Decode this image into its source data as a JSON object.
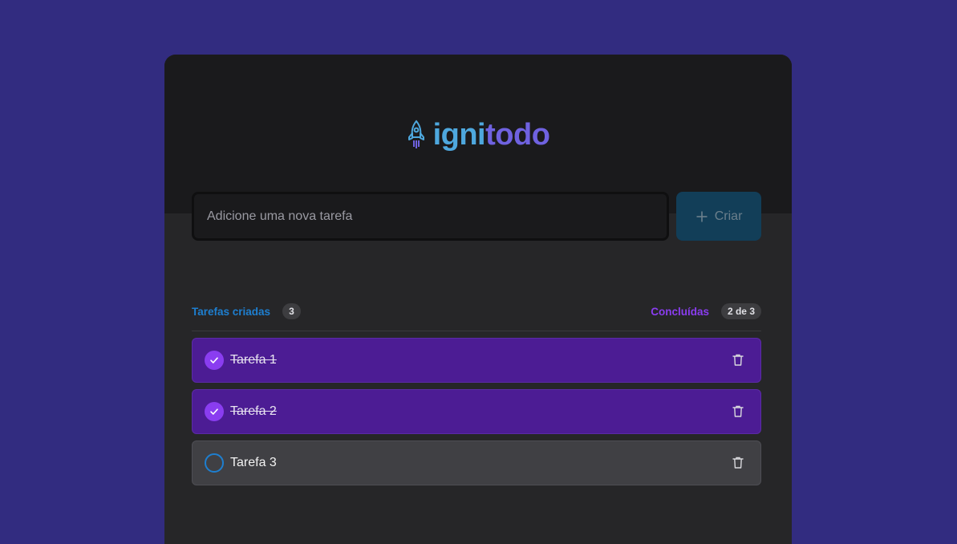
{
  "logo": {
    "part1": "igni",
    "part2": "todo"
  },
  "new_task": {
    "placeholder": "Adicione uma nova tarefa",
    "create_label": "Criar"
  },
  "counters": {
    "created_label": "Tarefas criadas",
    "created_count": "3",
    "done_label": "Concluídas",
    "done_count": "2 de 3"
  },
  "tasks": [
    {
      "title": "Tarefa 1",
      "done": true
    },
    {
      "title": "Tarefa 2",
      "done": true
    },
    {
      "title": "Tarefa 3",
      "done": false
    }
  ],
  "colors": {
    "background": "#322c80",
    "header": "#1a1a1c",
    "card": "#262628",
    "blue": "#1e7fd0",
    "purple": "#8a3df0",
    "task_done_bg": "#4c1c94",
    "task_pending_bg": "#404044"
  },
  "icons": {
    "logo": "rocket-icon",
    "create": "plus-icon",
    "check": "check-icon",
    "delete": "trash-icon"
  }
}
